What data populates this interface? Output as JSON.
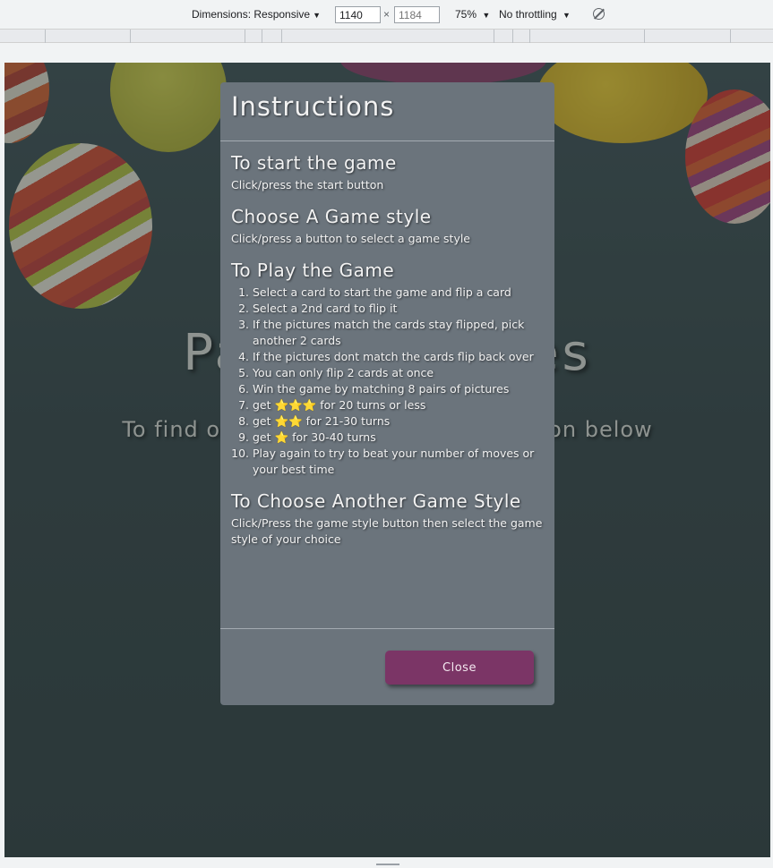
{
  "devtools": {
    "dimensions_label": "Dimensions: Responsive",
    "width": "1140",
    "height": "1184",
    "times": "×",
    "zoom": "75%",
    "throttling": "No throttling",
    "caret": "▼",
    "rotate_icon": "rotate-icon"
  },
  "page": {
    "bg_title": "Pairing Games",
    "bg_subtitle": "To find out how to play click the button below"
  },
  "modal": {
    "title": "Instructions",
    "sections": [
      {
        "heading": "To start the game",
        "text": "Click/press the start button"
      },
      {
        "heading": "Choose A Game style",
        "text": "Click/press a button to select a game style"
      },
      {
        "heading": "To Play the Game"
      },
      {
        "heading": "To Choose Another Game Style",
        "text": "Click/Press the game style button then select the game style of your choice"
      }
    ],
    "steps": [
      "Select a card to start the game and flip a card",
      "Select a 2nd card to flip it",
      "If the pictures match the cards stay flipped, pick another 2 cards",
      "If the pictures dont match the cards flip back over",
      "You can only flip 2 cards at once",
      "Win the game by matching 8 pairs of pictures"
    ],
    "star_steps": [
      {
        "prefix": "get",
        "stars": "⭐⭐⭐",
        "suffix": "for 20 turns or less"
      },
      {
        "prefix": "get",
        "stars": "⭐⭐",
        "suffix": "for 21-30 turns"
      },
      {
        "prefix": "get",
        "stars": "⭐",
        "suffix": "for 30-40 turns"
      }
    ],
    "last_step": "Play again to try to beat your number of moves or your best time",
    "close_label": "Close"
  }
}
